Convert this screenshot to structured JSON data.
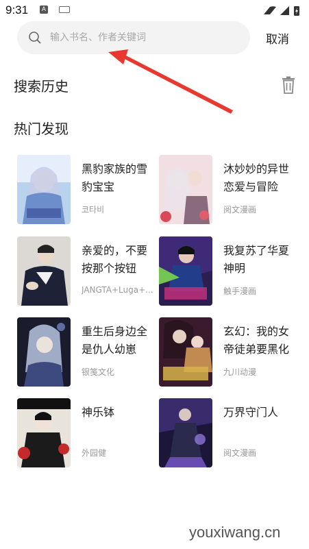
{
  "status_bar": {
    "time": "9:31",
    "input_badge": "A"
  },
  "search": {
    "placeholder": "输入书名、作者关键词",
    "value": "",
    "cancel_label": "取消"
  },
  "history": {
    "title": "搜索历史"
  },
  "hot": {
    "title": "热门发现",
    "books": [
      {
        "title": "黑豹家族的雪豹宝宝",
        "author": "코타비"
      },
      {
        "title": "沐妙妙的异世恋爱与冒险",
        "author": "阅文漫画"
      },
      {
        "title": "亲爱的，不要按那个按钮",
        "author": "JANGTA+Luga+..."
      },
      {
        "title": "我复苏了华夏神明",
        "author": "触手漫画"
      },
      {
        "title": "重生后身边全是仇人幼崽",
        "author": "银笺文化"
      },
      {
        "title": "玄幻：我的女帝徒弟要黑化",
        "author": "九川动漫"
      },
      {
        "title": "神乐钵",
        "author": "外园健"
      },
      {
        "title": "万界守门人",
        "author": "阅文漫画"
      }
    ]
  },
  "watermark": "youxiwang.cn",
  "colors": {
    "accent_red": "#e8382f",
    "search_bg": "#f3f3f3",
    "muted_text": "#999999"
  }
}
